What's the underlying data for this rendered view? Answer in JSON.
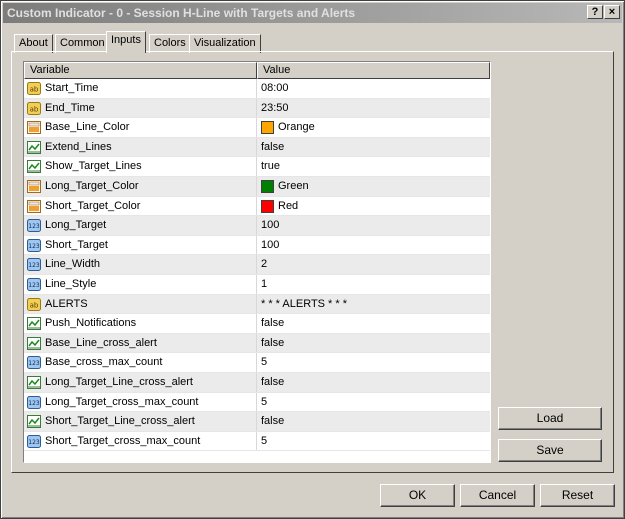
{
  "window": {
    "title": "Custom Indicator - 0 - Session H-Line  with Targets and Alerts",
    "help_label": "?",
    "close_label": "×"
  },
  "tabs": [
    {
      "label": "About"
    },
    {
      "label": "Common"
    },
    {
      "label": "Inputs",
      "active": true
    },
    {
      "label": "Colors"
    },
    {
      "label": "Visualization"
    }
  ],
  "grid": {
    "headers": {
      "variable": "Variable",
      "value": "Value"
    },
    "rows": [
      {
        "type": "string",
        "name": "Start_Time",
        "value": "08:00"
      },
      {
        "type": "string",
        "name": "End_Time",
        "value": "23:50"
      },
      {
        "type": "color",
        "name": "Base_Line_Color",
        "value": "Orange",
        "color": "#ffa500"
      },
      {
        "type": "bool",
        "name": "Extend_Lines",
        "value": "false"
      },
      {
        "type": "bool",
        "name": "Show_Target_Lines",
        "value": "true"
      },
      {
        "type": "color",
        "name": "Long_Target_Color",
        "value": "Green",
        "color": "#008000"
      },
      {
        "type": "color",
        "name": "Short_Target_Color",
        "value": "Red",
        "color": "#ff0000"
      },
      {
        "type": "int",
        "name": "Long_Target",
        "value": "100"
      },
      {
        "type": "int",
        "name": "Short_Target",
        "value": "100"
      },
      {
        "type": "int",
        "name": "Line_Width",
        "value": "2"
      },
      {
        "type": "int",
        "name": "Line_Style",
        "value": "1"
      },
      {
        "type": "string",
        "name": "ALERTS",
        "value": "* * * ALERTS * * *"
      },
      {
        "type": "bool",
        "name": "Push_Notifications",
        "value": "false"
      },
      {
        "type": "bool",
        "name": "Base_Line_cross_alert",
        "value": "false"
      },
      {
        "type": "int",
        "name": "Base_cross_max_count",
        "value": "5"
      },
      {
        "type": "bool",
        "name": "Long_Target_Line_cross_alert",
        "value": "false"
      },
      {
        "type": "int",
        "name": "Long_Target_cross_max_count",
        "value": "5"
      },
      {
        "type": "bool",
        "name": "Short_Target_Line_cross_alert",
        "value": "false"
      },
      {
        "type": "int",
        "name": "Short_Target_cross_max_count",
        "value": "5"
      }
    ]
  },
  "side_buttons": {
    "load": "Load",
    "save": "Save"
  },
  "footer_buttons": {
    "ok": "OK",
    "cancel": "Cancel",
    "reset": "Reset"
  }
}
